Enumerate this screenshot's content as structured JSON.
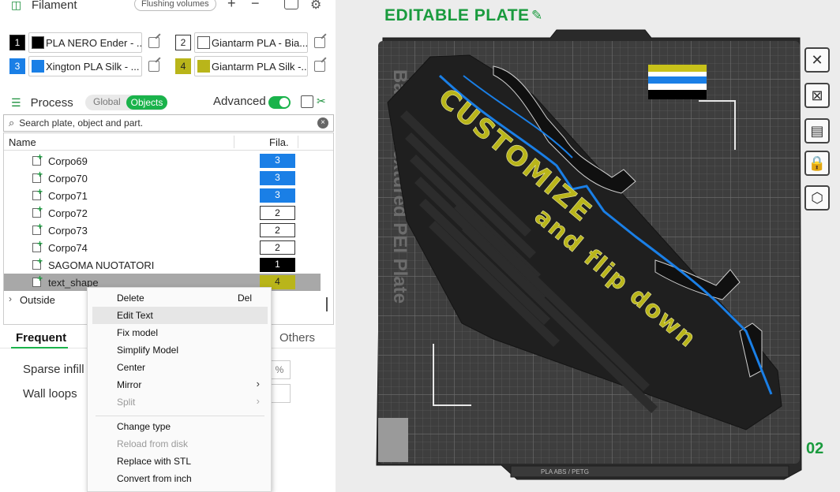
{
  "filament": {
    "title": "Filament",
    "flushing_label": "Flushing volumes",
    "plus": "+",
    "minus": "−",
    "items": [
      {
        "num": "1",
        "name": "PLA NERO Ender - ...",
        "num_bg": "#000000",
        "num_fg": "#ffffff",
        "swatch": "#000000"
      },
      {
        "num": "2",
        "name": "Giantarm PLA - Bia...",
        "num_bg": "#ffffff",
        "num_fg": "#222222",
        "swatch": "#ffffff"
      },
      {
        "num": "3",
        "name": "Xington PLA Silk - ...",
        "num_bg": "#1a7fe6",
        "num_fg": "#ffffff",
        "swatch": "#1a7fe6"
      },
      {
        "num": "4",
        "name": "Giantarm PLA Silk -...",
        "num_bg": "#b9b51a",
        "num_fg": "#222222",
        "swatch": "#b9b51a"
      }
    ]
  },
  "process": {
    "title": "Process",
    "seg_global": "Global",
    "seg_objects": "Objects",
    "advanced_label": "Advanced",
    "advanced_on": true
  },
  "search": {
    "placeholder": "Search plate, object and part.",
    "clear": "×"
  },
  "tree": {
    "col_name": "Name",
    "col_fila": "Fila.",
    "rows": [
      {
        "name": "Corpo69",
        "fila": "3",
        "bg": "#1a7fe6",
        "fg": "#ffffff"
      },
      {
        "name": "Corpo70",
        "fila": "3",
        "bg": "#1a7fe6",
        "fg": "#ffffff"
      },
      {
        "name": "Corpo71",
        "fila": "3",
        "bg": "#1a7fe6",
        "fg": "#ffffff"
      },
      {
        "name": "Corpo72",
        "fila": "2",
        "bg": "#ffffff",
        "fg": "#111111"
      },
      {
        "name": "Corpo73",
        "fila": "2",
        "bg": "#ffffff",
        "fg": "#111111"
      },
      {
        "name": "Corpo74",
        "fila": "2",
        "bg": "#ffffff",
        "fg": "#111111"
      },
      {
        "name": "SAGOMA NUOTATORI",
        "fila": "1",
        "bg": "#000000",
        "fg": "#ffffff"
      },
      {
        "name": "text_shape",
        "fila": "4",
        "bg": "#b9b51a",
        "fg": "#222222"
      }
    ],
    "outside": "Outside"
  },
  "settings": {
    "tab_frequent": "Frequent",
    "tab_others": "Others",
    "sparse_infill": "Sparse infill",
    "wall_loops": "Wall loops",
    "sparse_unit": "%"
  },
  "context_menu": {
    "items": [
      {
        "label": "Delete",
        "accel": "Del",
        "disabled": false,
        "submenu": false,
        "highlight": false
      },
      {
        "label": "Edit Text",
        "accel": "",
        "disabled": false,
        "submenu": false,
        "highlight": true
      },
      {
        "label": "Fix model",
        "accel": "",
        "disabled": false,
        "submenu": false,
        "highlight": false
      },
      {
        "label": "Simplify Model",
        "accel": "",
        "disabled": false,
        "submenu": false,
        "highlight": false
      },
      {
        "label": "Center",
        "accel": "",
        "disabled": false,
        "submenu": false,
        "highlight": false
      },
      {
        "label": "Mirror",
        "accel": "",
        "disabled": false,
        "submenu": true,
        "highlight": false
      },
      {
        "label": "Split",
        "accel": "",
        "disabled": true,
        "submenu": true,
        "highlight": false
      },
      {
        "label": "Change type",
        "accel": "",
        "disabled": false,
        "submenu": false,
        "highlight": false
      },
      {
        "label": "Reload from disk",
        "accel": "",
        "disabled": true,
        "submenu": false,
        "highlight": false
      },
      {
        "label": "Replace with STL",
        "accel": "",
        "disabled": false,
        "submenu": false,
        "highlight": false
      },
      {
        "label": "Convert from inch",
        "accel": "",
        "disabled": false,
        "submenu": false,
        "highlight": false
      }
    ]
  },
  "plate": {
    "title": "EDITABLE PLATE",
    "number": "02",
    "bed_label": "Bambu Textured PEI Plate",
    "model_text_line1": "CUSTOMIZE",
    "model_text_line2": "and flip down",
    "bottom_bar_text": "PLA  ABS / PETG",
    "flag_colors": [
      "#c8c21a",
      "#ffffff",
      "#1a7fe6",
      "#ffffff",
      "#000000"
    ],
    "side_buttons": [
      "close-icon",
      "auto-orient-icon",
      "arrange-icon",
      "lock-icon",
      "settings-icon"
    ]
  },
  "colors": {
    "accent": "#1ab34b",
    "plate_green": "#1a9b3e",
    "bed": "#3e3e3e",
    "model": "#202020",
    "text_yellow": "#b9b51a",
    "wave_blue": "#1a7fe6"
  }
}
